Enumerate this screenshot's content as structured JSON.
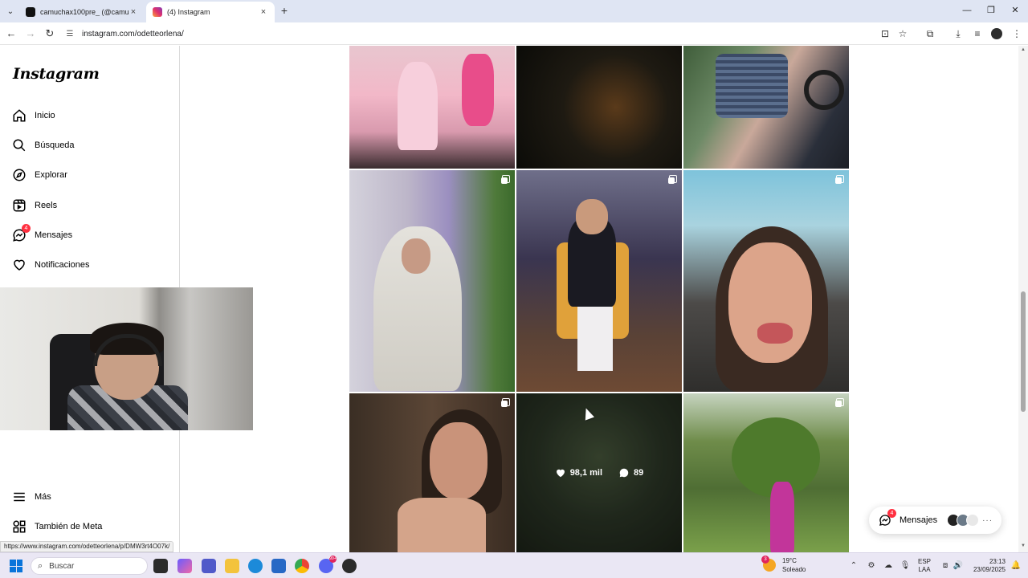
{
  "browser": {
    "tabs": [
      {
        "title": "camuchax100pre_ (@camucha...",
        "active": false
      },
      {
        "title": "(4) Instagram",
        "active": true
      }
    ],
    "new_tab": "+",
    "url": "instagram.com/odetteorlena/",
    "status_url": "https://www.instagram.com/odetteorlena/p/DMW3rt4O07k/"
  },
  "sidebar": {
    "logo": "Instagram",
    "items": [
      {
        "label": "Inicio",
        "icon": "home-icon"
      },
      {
        "label": "Búsqueda",
        "icon": "search-icon"
      },
      {
        "label": "Explorar",
        "icon": "compass-icon"
      },
      {
        "label": "Reels",
        "icon": "reels-icon"
      },
      {
        "label": "Mensajes",
        "icon": "messenger-icon",
        "badge": "4"
      },
      {
        "label": "Notificaciones",
        "icon": "heart-icon"
      }
    ],
    "bottom_items": [
      {
        "label": "Más",
        "icon": "menu-icon"
      },
      {
        "label": "También de Meta",
        "icon": "meta-apps-icon"
      }
    ]
  },
  "grid": {
    "hover_post": {
      "likes": "98,1 mil",
      "comments": "89"
    }
  },
  "messages_pill": {
    "label": "Mensajes",
    "badge": "4",
    "more": "···"
  },
  "taskbar": {
    "search_placeholder": "Buscar",
    "weather": {
      "temp": "19°C",
      "condition": "Soleado",
      "badge": "3"
    },
    "lang": {
      "line1": "ESP",
      "line2": "LAA"
    },
    "clock": {
      "time": "23:13",
      "date": "23/09/2025"
    },
    "app_badge": "99+"
  },
  "colors": {
    "accent": "#0095f6",
    "badge": "#ff3040",
    "tabbar": "#dfe5f3"
  }
}
